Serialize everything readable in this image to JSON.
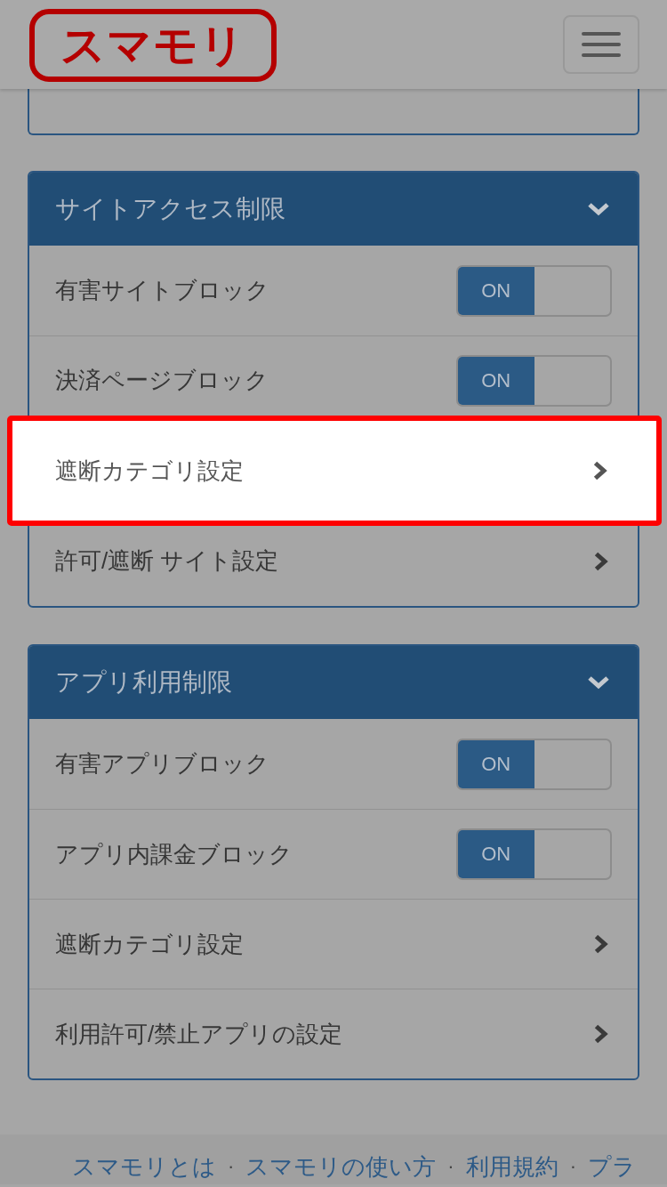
{
  "header": {
    "logo": "スマモリ"
  },
  "sections": [
    {
      "title": "サイトアクセス制限",
      "expanded": true,
      "rows": [
        {
          "kind": "toggle",
          "label": "有害サイトブロック",
          "on": true,
          "toggle_text": "ON",
          "highlighted": false
        },
        {
          "kind": "toggle",
          "label": "決済ページブロック",
          "on": true,
          "toggle_text": "ON",
          "highlighted": false
        },
        {
          "kind": "link",
          "label": "遮断カテゴリ設定",
          "highlighted": true
        },
        {
          "kind": "link",
          "label": "許可/遮断 サイト設定",
          "highlighted": false
        }
      ]
    },
    {
      "title": "アプリ利用制限",
      "expanded": true,
      "rows": [
        {
          "kind": "toggle",
          "label": "有害アプリブロック",
          "on": true,
          "toggle_text": "ON",
          "highlighted": false
        },
        {
          "kind": "toggle",
          "label": "アプリ内課金ブロック",
          "on": true,
          "toggle_text": "ON",
          "highlighted": false
        },
        {
          "kind": "link",
          "label": "遮断カテゴリ設定",
          "highlighted": false
        },
        {
          "kind": "link",
          "label": "利用許可/禁止アプリの設定",
          "highlighted": false
        }
      ]
    }
  ],
  "footer": {
    "items": [
      {
        "kind": "link",
        "text": "スマモリとは"
      },
      {
        "kind": "separator",
        "text": "·"
      },
      {
        "kind": "link",
        "text": "スマモリの使い方"
      },
      {
        "kind": "separator",
        "text": "·"
      },
      {
        "kind": "link",
        "text": "利用規約"
      },
      {
        "kind": "separator",
        "text": "·"
      },
      {
        "kind": "link",
        "text": "プラ"
      }
    ]
  }
}
